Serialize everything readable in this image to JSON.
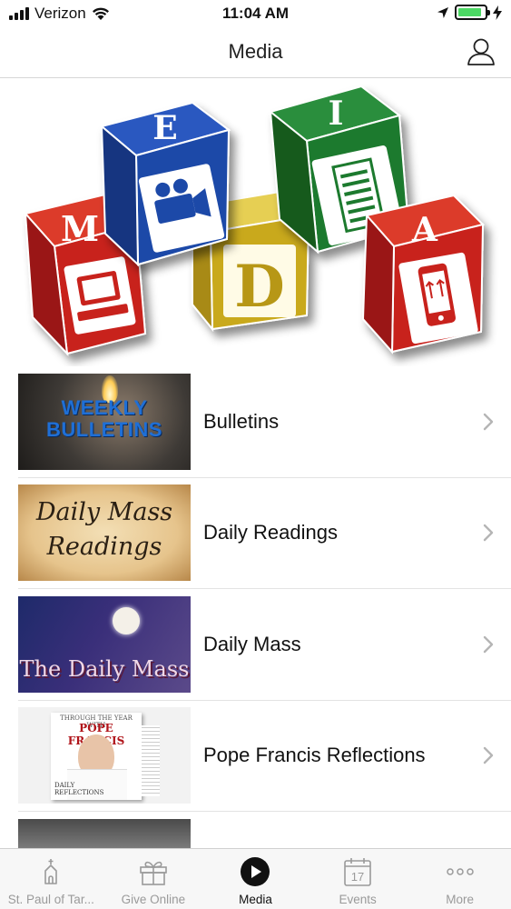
{
  "status_bar": {
    "carrier": "Verizon",
    "time": "11:04 AM"
  },
  "nav": {
    "title": "Media"
  },
  "hero": {
    "blocks": [
      "M",
      "E",
      "D",
      "I",
      "A"
    ],
    "colors": {
      "red": "#c8201e",
      "blue": "#1f4aa8",
      "yellow": "#d2b21a",
      "green": "#1e7a2e"
    }
  },
  "media_list": {
    "items": [
      {
        "label": "Bulletins",
        "thumb_text_1": "WEEKLY",
        "thumb_text_2": "BULLETINS"
      },
      {
        "label": "Daily Readings",
        "thumb_text_1": "Daily Mass",
        "thumb_text_2": "Readings"
      },
      {
        "label": "Daily Mass",
        "thumb_text_1": "The Daily Mass"
      },
      {
        "label": "Pope Francis Reflections",
        "thumb_text_1": "THROUGH THE YEAR WITH",
        "thumb_text_2": "POPE FRANCIS",
        "thumb_text_3": "DAILY",
        "thumb_text_4": "REFLECTIONS"
      },
      {
        "label": ""
      }
    ]
  },
  "tab_bar": {
    "tabs": [
      {
        "label": "St. Paul of Tar...",
        "icon": "church-icon",
        "active": false
      },
      {
        "label": "Give Online",
        "icon": "gift-icon",
        "active": false
      },
      {
        "label": "Media",
        "icon": "play-icon",
        "active": true
      },
      {
        "label": "Events",
        "icon": "calendar-icon",
        "calendar_day": "17",
        "active": false
      },
      {
        "label": "More",
        "icon": "more-icon",
        "active": false
      }
    ]
  }
}
